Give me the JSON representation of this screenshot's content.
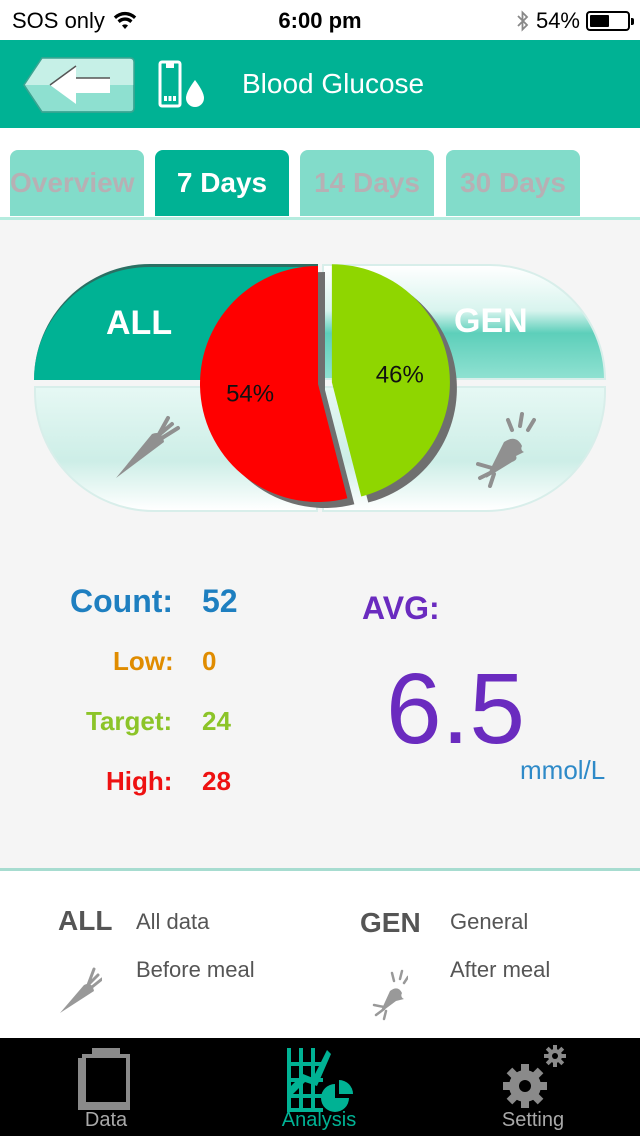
{
  "status_bar": {
    "carrier": "SOS only",
    "time": "6:00 pm",
    "battery_percent": "54%",
    "battery_level": 0.54,
    "icons": [
      "wifi-icon",
      "bluetooth-icon",
      "battery-icon"
    ]
  },
  "header": {
    "title": "Blood Glucose",
    "back_icon": "back-arrow-icon",
    "meter_icon": "glucose-meter-icon"
  },
  "tabs": [
    {
      "label": "Overview",
      "active": false
    },
    {
      "label": "7 Days",
      "active": true
    },
    {
      "label": "14 Days",
      "active": false
    },
    {
      "label": "30 Days",
      "active": false
    }
  ],
  "filters": {
    "all_label": "ALL",
    "gen_label": "GEN",
    "before_meal_icon": "carrot-icon",
    "after_meal_icon": "bitten-carrot-icon"
  },
  "colors": {
    "accent": "#00b294",
    "high": "#ff0000",
    "target": "#8fd600",
    "low": "#e08c00",
    "count": "#1e7fc0",
    "avg": "#6a2bbf"
  },
  "chart_data": {
    "type": "pie",
    "title": "",
    "slices": [
      {
        "label": "54%",
        "category": "High",
        "value": 54,
        "color": "#ff0000"
      },
      {
        "label": "46%",
        "category": "Target",
        "value": 46,
        "color": "#8fd600"
      }
    ]
  },
  "stats": {
    "count": {
      "label": "Count:",
      "value": "52"
    },
    "low": {
      "label": "Low:",
      "value": "0"
    },
    "target": {
      "label": "Target:",
      "value": "24"
    },
    "high": {
      "label": "High:",
      "value": "28"
    }
  },
  "average": {
    "label": "AVG:",
    "value": "6.5",
    "unit": "mmol/L"
  },
  "legend": [
    {
      "key": "ALL",
      "text": "All data"
    },
    {
      "key": "GEN",
      "text": "General"
    },
    {
      "icon": "carrot-icon",
      "text": "Before meal"
    },
    {
      "icon": "bitten-carrot-icon",
      "text": "After meal"
    }
  ],
  "tab_bar": [
    {
      "label": "Data",
      "icon": "clipboard-icon",
      "active": false
    },
    {
      "label": "Analysis",
      "icon": "analysis-chart-icon",
      "active": true
    },
    {
      "label": "Setting",
      "icon": "gear-icon",
      "active": false
    }
  ]
}
